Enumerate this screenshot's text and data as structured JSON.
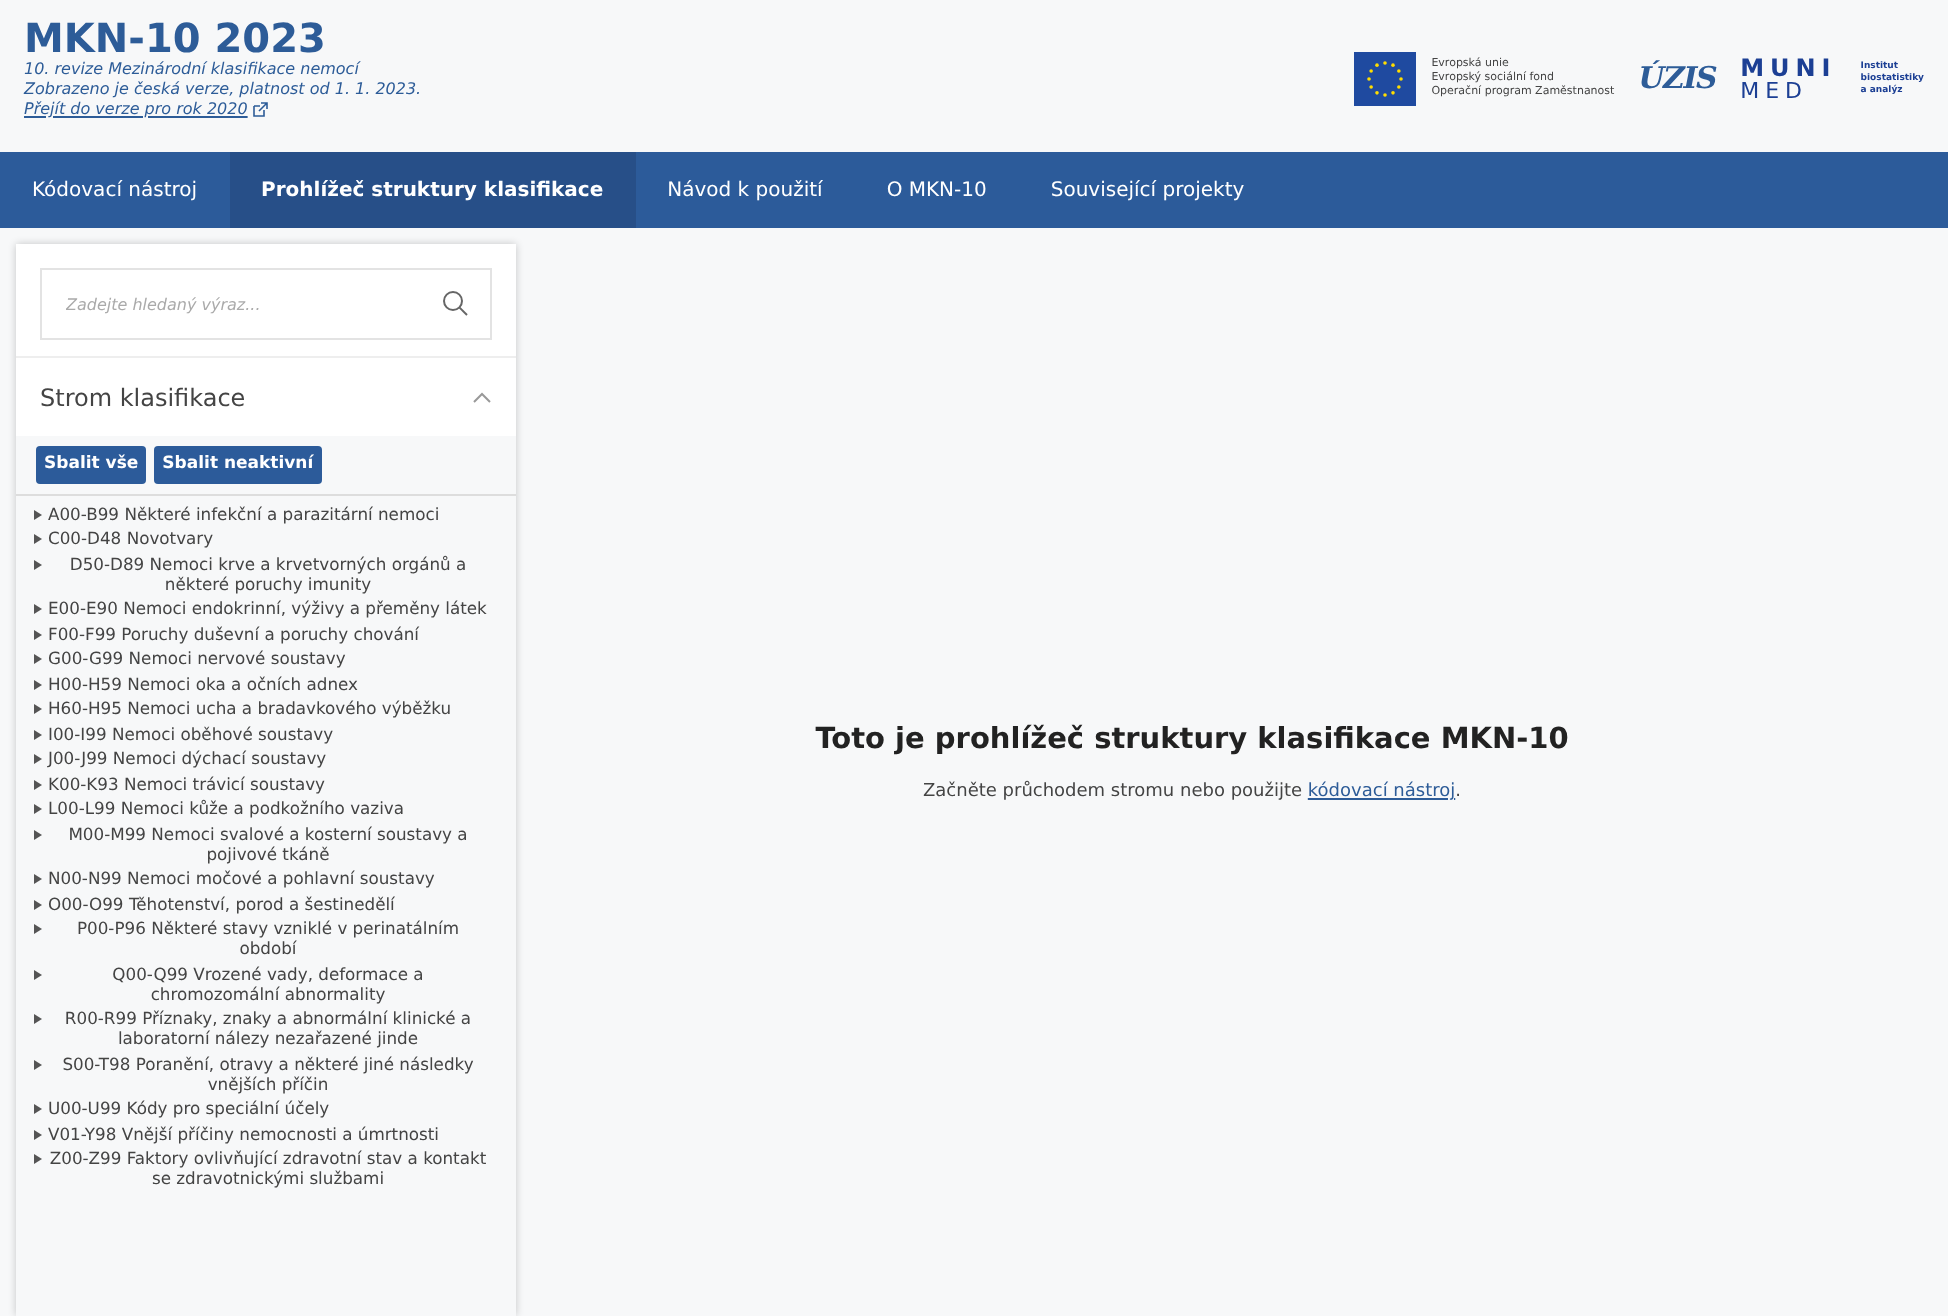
{
  "header": {
    "title": "MKN-10 2023",
    "subtitle_lines": [
      "10. revize Mezinárodní klasifikace nemocí",
      "Zobrazeno je česká verze, platnost od 1. 1. 2023."
    ],
    "old_version_link": "Přejít do verze pro rok 2020",
    "logos": {
      "eu_lines": [
        "Evropská unie",
        "Evropský sociální fond",
        "Operační program Zaměstnanost"
      ],
      "uzis": "ÚZIS",
      "muni_top": "MUNI",
      "muni_bottom": "MED",
      "iba_lines": [
        "Institut",
        "biostatistiky",
        "a analýz"
      ]
    }
  },
  "nav": [
    {
      "label": "Kódovací nástroj",
      "selected": false
    },
    {
      "label": "Prohlížeč struktury klasifikace",
      "selected": true
    },
    {
      "label": "Návod k použití",
      "selected": false
    },
    {
      "label": "O MKN-10",
      "selected": false
    },
    {
      "label": "Související projekty",
      "selected": false
    }
  ],
  "sidebar": {
    "search": {
      "placeholder": "Zadejte hledaný výraz..."
    },
    "tree_title": "Strom klasifikace",
    "expanded": true,
    "buttons": [
      "Sbalit vše",
      "Sbalit neaktivní"
    ],
    "items": [
      {
        "code": "A00-B99",
        "label": "Některé infekční a parazitární nemoci"
      },
      {
        "code": "C00-D48",
        "label": "Novotvary"
      },
      {
        "code": "D50-D89",
        "label": "Nemoci krve a krvetvorných orgánů a některé poruchy imunity"
      },
      {
        "code": "E00-E90",
        "label": "Nemoci endokrinní, výživy a přeměny látek"
      },
      {
        "code": "F00-F99",
        "label": "Poruchy duševní a poruchy chování"
      },
      {
        "code": "G00-G99",
        "label": "Nemoci nervové soustavy"
      },
      {
        "code": "H00-H59",
        "label": "Nemoci oka a očních adnex"
      },
      {
        "code": "H60-H95",
        "label": "Nemoci ucha a bradavkového výběžku"
      },
      {
        "code": "I00-I99",
        "label": "Nemoci oběhové soustavy"
      },
      {
        "code": "J00-J99",
        "label": "Nemoci dýchací soustavy"
      },
      {
        "code": "K00-K93",
        "label": "Nemoci trávicí soustavy"
      },
      {
        "code": "L00-L99",
        "label": "Nemoci kůže a podkožního vaziva"
      },
      {
        "code": "M00-M99",
        "label": "Nemoci svalové a kosterní soustavy a pojivové tkáně"
      },
      {
        "code": "N00-N99",
        "label": "Nemoci močové a pohlavní soustavy"
      },
      {
        "code": "O00-O99",
        "label": "Těhotenství, porod a šestinedělí"
      },
      {
        "code": "P00-P96",
        "label": "Některé stavy vzniklé v perinatálním období"
      },
      {
        "code": "Q00-Q99",
        "label": "Vrozené vady, deformace a chromozomální abnormality"
      },
      {
        "code": "R00-R99",
        "label": "Příznaky, znaky a abnormální klinické a laboratorní nálezy nezařazené jinde"
      },
      {
        "code": "S00-T98",
        "label": "Poranění, otravy a některé jiné následky vnějších příčin"
      },
      {
        "code": "U00-U99",
        "label": "Kódy pro speciální účely"
      },
      {
        "code": "V01-Y98",
        "label": "Vnější příčiny nemocnosti a úmrtnosti"
      },
      {
        "code": "Z00-Z99",
        "label": "Faktory ovlivňující zdravotní stav a kontakt se zdravotnickými službami"
      }
    ]
  },
  "main": {
    "heading": "Toto je prohlížeč struktury klasifikace MKN-10",
    "text_before": "Začněte průchodem stromu nebo použijte",
    "link": "kódovací nástroj",
    "text_after": "."
  }
}
